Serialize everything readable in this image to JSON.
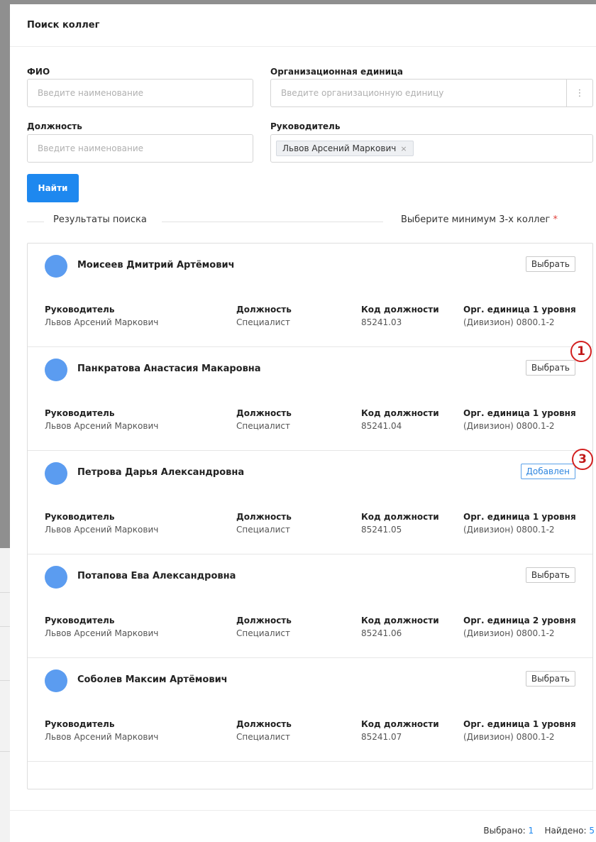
{
  "dialog": {
    "title": "Поиск коллег"
  },
  "form": {
    "fio": {
      "label": "ФИО",
      "placeholder": "Введите наименование"
    },
    "org_unit": {
      "label": "Организационная единица",
      "placeholder": "Введите организационную единицу",
      "more_icon": "⋮"
    },
    "position": {
      "label": "Должность",
      "placeholder": "Введите наименование"
    },
    "manager": {
      "label": "Руководитель",
      "tag": "Львов Арсений Маркович",
      "remove_icon": "×"
    },
    "search_button": "Найти"
  },
  "results_header": {
    "title": "Результаты поиска",
    "hint": "Выберите минимум 3-х коллег",
    "required_mark": "*"
  },
  "columns": {
    "manager": "Руководитель",
    "position": "Должность",
    "code": "Код должности"
  },
  "results": [
    {
      "name": "Моисеев Дмитрий Артёмович",
      "button": "Выбрать",
      "added": false,
      "manager": "Львов Арсений Маркович",
      "position": "Специалист",
      "code": "85241.03",
      "org_header": "Орг. единица 1 уровня",
      "org_value": "(Дивизион) 0800.1-2"
    },
    {
      "name": "Панкратова Анастасия Макаровна",
      "button": "Выбрать",
      "added": false,
      "manager": "Львов Арсений Маркович",
      "position": "Специалист",
      "code": "85241.04",
      "org_header": "Орг. единица 1 уровня",
      "org_value": "(Дивизион) 0800.1-2"
    },
    {
      "name": "Петрова Дарья Александровна",
      "button": "Добавлен",
      "added": true,
      "manager": "Львов Арсений Маркович",
      "position": "Специалист",
      "code": "85241.05",
      "org_header": "Орг. единица 1 уровня",
      "org_value": "(Дивизион) 0800.1-2"
    },
    {
      "name": "Потапова Ева Александровна",
      "button": "Выбрать",
      "added": false,
      "manager": "Львов Арсений Маркович",
      "position": "Специалист",
      "code": "85241.06",
      "org_header": "Орг. единица 2 уровня",
      "org_value": "(Дивизион) 0800.1-2"
    },
    {
      "name": "Соболев Максим Артёмович",
      "button": "Выбрать",
      "added": false,
      "manager": "Львов Арсений Маркович",
      "position": "Специалист",
      "code": "85241.07",
      "org_header": "Орг. единица 1 уровня",
      "org_value": "(Дивизион) 0800.1-2"
    }
  ],
  "footer": {
    "selected_label": "Выбрано:",
    "selected_count": "1",
    "found_label": "Найдено:",
    "found_count": "5"
  },
  "annotations": [
    {
      "label": "1"
    },
    {
      "label": "3"
    }
  ],
  "colors": {
    "primary": "#1e88ef",
    "avatar": "#5b9cf0",
    "marker": "#d32020",
    "required": "#e0403a"
  }
}
